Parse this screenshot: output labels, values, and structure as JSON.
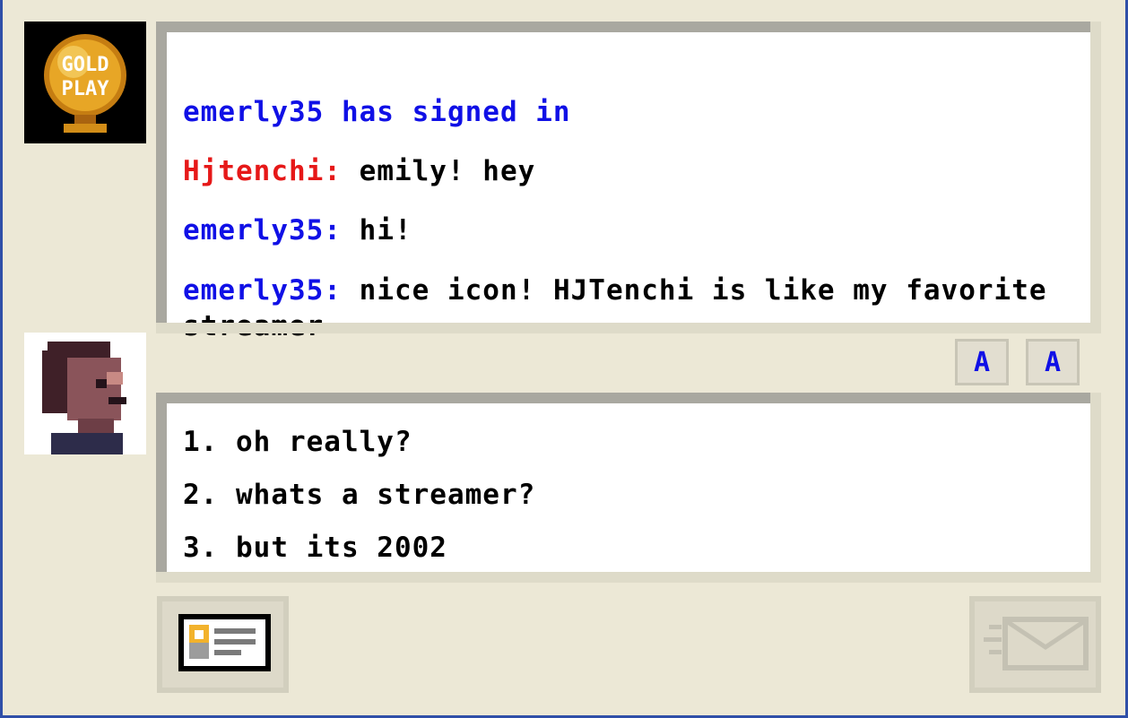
{
  "buddy_avatar": {
    "icon": "gold-play-badge-icon",
    "text": "GOLD PLAY"
  },
  "self_avatar": {
    "icon": "pixel-portrait-icon"
  },
  "chat_log": {
    "system_message": "emerly35 has signed in",
    "messages": [
      {
        "sender": "Hjtenchi:",
        "text": "emily! hey",
        "sender_color": "#e61818"
      },
      {
        "sender": "emerly35:",
        "text": "hi!",
        "sender_color": "#1010e6"
      },
      {
        "sender": "emerly35:",
        "text": "nice icon! HJTenchi is like my favorite streamer",
        "sender_color": "#1010e6"
      }
    ]
  },
  "format_toolbar": {
    "font_label": "A",
    "color_label": "A"
  },
  "reply_options": [
    "1. oh really?",
    "2. whats a streamer?",
    "3. but its 2002"
  ],
  "buttons": {
    "profile_icon": "profile-card-icon",
    "send_icon": "send-envelope-icon"
  }
}
